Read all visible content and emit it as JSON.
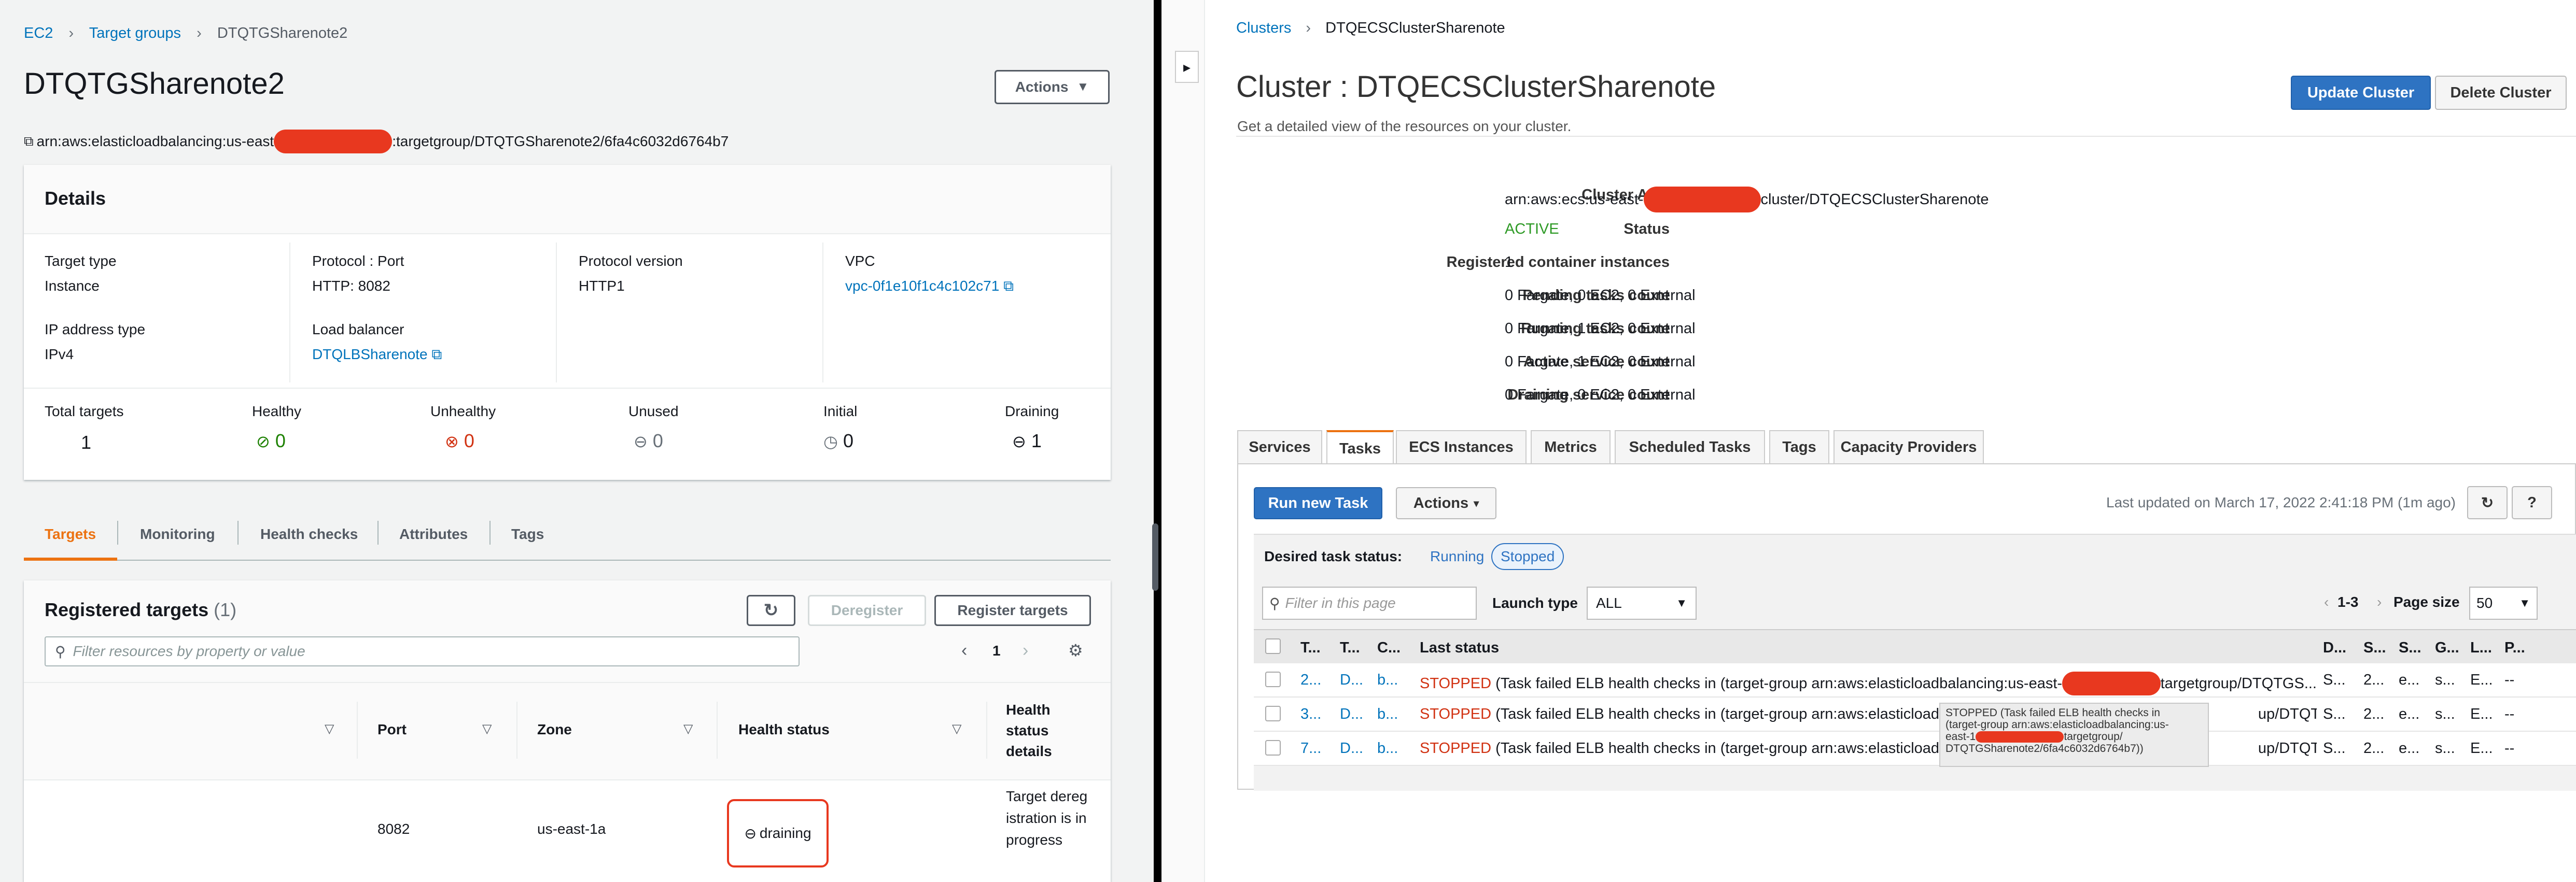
{
  "left": {
    "breadcrumb": [
      "EC2",
      "Target groups",
      "DTQTGSharenote2"
    ],
    "title": "DTQTGSharenote2",
    "actions_label": "Actions",
    "arn_prefix": "arn:aws:elasticloadbalancing:us-east",
    "arn_suffix": ":targetgroup/DTQTGSharenote2/6fa4c6032d6764b7",
    "details": {
      "heading": "Details",
      "target_type_label": "Target type",
      "target_type": "Instance",
      "protocol_port_label": "Protocol : Port",
      "protocol_port": "HTTP: 8082",
      "protocol_version_label": "Protocol version",
      "protocol_version": "HTTP1",
      "vpc_label": "VPC",
      "vpc": "vpc-0f1e10f1c4c102c71",
      "ip_label": "IP address type",
      "ip": "IPv4",
      "lb_label": "Load balancer",
      "lb": "DTQLBSharenote"
    },
    "stats": [
      {
        "label": "Total targets",
        "value": "1"
      },
      {
        "label": "Healthy",
        "value": "0"
      },
      {
        "label": "Unhealthy",
        "value": "0"
      },
      {
        "label": "Unused",
        "value": "0"
      },
      {
        "label": "Initial",
        "value": "0"
      },
      {
        "label": "Draining",
        "value": "1"
      }
    ],
    "tabs": [
      "Targets",
      "Monitoring",
      "Health checks",
      "Attributes",
      "Tags"
    ],
    "registered": {
      "title": "Registered targets",
      "count": "(1)",
      "deregister": "Deregister",
      "register": "Register targets",
      "filter_placeholder": "Filter resources by property or value",
      "page": "1",
      "columns": [
        "Port",
        "Zone",
        "Health status",
        "Health status details"
      ],
      "row": {
        "port": "8082",
        "zone": "us-east-1a",
        "health": "draining",
        "details": "Target deregistration is in progress"
      }
    }
  },
  "right": {
    "breadcrumb": [
      "Clusters",
      "DTQECSClusterSharenote"
    ],
    "title": "Cluster : DTQECSClusterSharenote",
    "subtitle": "Get a detailed view of the resources on your cluster.",
    "update_btn": "Update Cluster",
    "delete_btn": "Delete Cluster",
    "info": [
      {
        "label": "Cluster ARN",
        "value": "arn:aws:ecs:us-east-",
        "value2": "cluster/DTQECSClusterSharenote"
      },
      {
        "label": "Status",
        "value": "ACTIVE"
      },
      {
        "label": "Registered container instances",
        "value": "1"
      },
      {
        "label": "Pending tasks count",
        "value": "0 Fargate, 0 EC2, 0 External"
      },
      {
        "label": "Running tasks count",
        "value": "0 Fargate, 1 EC2, 0 External"
      },
      {
        "label": "Active service count",
        "value": "0 Fargate, 1 EC2, 0 External"
      },
      {
        "label": "Draining service count",
        "value": "0 Fargate, 0 EC2, 0 External"
      }
    ],
    "tabs": [
      "Services",
      "Tasks",
      "ECS Instances",
      "Metrics",
      "Scheduled Tasks",
      "Tags",
      "Capacity Providers"
    ],
    "run_task": "Run new Task",
    "actions": "Actions",
    "last_updated": "Last updated on March 17, 2022 2:41:18 PM (1m ago)",
    "desired_label": "Desired task status:",
    "desired_running": "Running",
    "desired_stopped": "Stopped",
    "filter_placeholder": "Filter in this page",
    "launch_type_label": "Launch type",
    "launch_type_value": "ALL",
    "pagination": "1-3",
    "page_size_label": "Page size",
    "page_size": "50",
    "columns": [
      "T...",
      "T...",
      "C...",
      "Last status",
      "D...",
      "S...",
      "S...",
      "G...",
      "L...",
      "P..."
    ],
    "rows": [
      {
        "c1": "2...",
        "c2": "D...",
        "c3": "b...",
        "status": "STOPPED",
        "text": "(Task failed ELB health checks in (target-group arn:aws:elasticloadbalancing:us-east-",
        "tail": "targetgroup/DTQTGS...",
        "r": [
          "S...",
          "2...",
          "e...",
          "s...",
          "E...",
          "--"
        ]
      },
      {
        "c1": "3...",
        "c2": "D...",
        "c3": "b...",
        "status": "STOPPED",
        "text": "(Task failed ELB health checks in (target-group arn:aws:elasticloadbala",
        "tail": "up/DTQTGS...",
        "r": [
          "S...",
          "2...",
          "e...",
          "s...",
          "E...",
          "--"
        ]
      },
      {
        "c1": "7...",
        "c2": "D...",
        "c3": "b...",
        "status": "STOPPED",
        "text": "(Task failed ELB health checks in (target-group arn:aws:elasticloadbala",
        "tail": "up/DTQTGS...",
        "r": [
          "S...",
          "2...",
          "e...",
          "s...",
          "E...",
          "--"
        ]
      }
    ],
    "tooltip": [
      "STOPPED (Task failed ELB health checks in",
      "(target-group arn:aws:elasticloadbalancing:us-",
      "east-1",
      "targetgroup/",
      "DTQTGSharenote2/6fa4c6032d6764b7))"
    ]
  }
}
